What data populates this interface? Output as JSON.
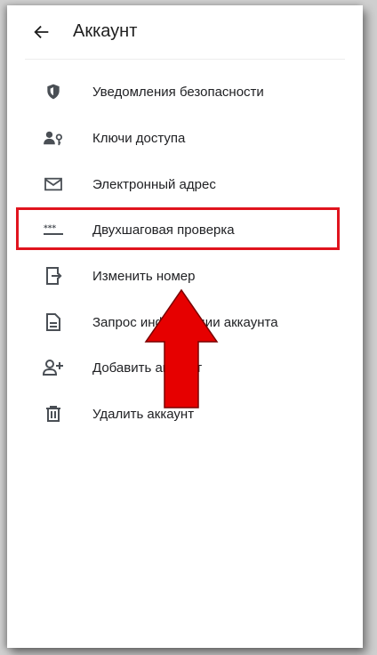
{
  "header": {
    "title": "Аккаунт",
    "back_icon": "arrow-left-icon"
  },
  "menu": {
    "items": [
      {
        "label": "Уведомления безопасности",
        "icon": "shield-icon"
      },
      {
        "label": "Ключи доступа",
        "icon": "passkey-icon"
      },
      {
        "label": "Электронный адрес",
        "icon": "mail-icon"
      },
      {
        "label": "Двухшаговая проверка",
        "icon": "password-dots-icon"
      },
      {
        "label": "Изменить номер",
        "icon": "change-number-icon"
      },
      {
        "label": "Запрос информации аккаунта",
        "icon": "document-icon"
      },
      {
        "label": "Добавить аккаунт",
        "icon": "add-person-icon"
      },
      {
        "label": "Удалить аккаунт",
        "icon": "trash-icon"
      }
    ]
  },
  "annotation": {
    "highlight_color": "#e0141e",
    "arrow_color": "#e60000"
  }
}
